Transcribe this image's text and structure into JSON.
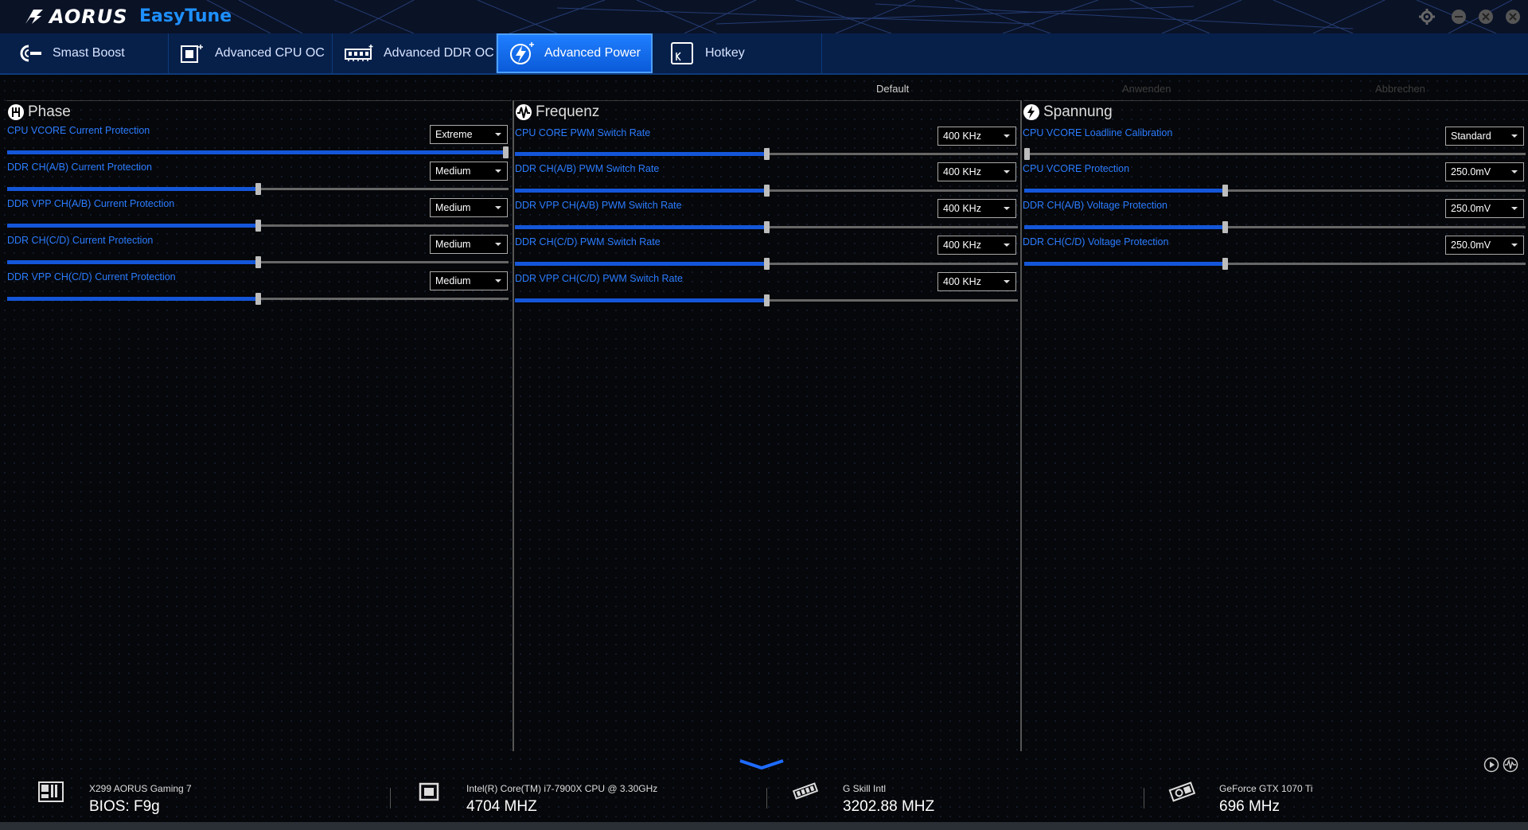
{
  "app": {
    "brand": "AORUS",
    "name": "EasyTune"
  },
  "tabs": [
    {
      "label": "Smast Boost",
      "icon": "smart-boost-icon",
      "active": false
    },
    {
      "label": "Advanced CPU OC",
      "icon": "cpu-chip-icon",
      "active": false
    },
    {
      "label": "Advanced DDR OC",
      "icon": "memory-module-icon",
      "active": false
    },
    {
      "label": "Advanced Power",
      "icon": "lightning-icon",
      "active": true
    },
    {
      "label": "Hotkey",
      "icon": "keyboard-key-icon",
      "active": false
    }
  ],
  "actions": {
    "default": "Default",
    "apply": "Anwenden",
    "cancel": "Abbrechen"
  },
  "colors": {
    "accent": "#1e90ff",
    "label": "#2b7cff",
    "slider_fill": "#1456d9",
    "active_tab": "#1f7fff"
  },
  "panels": [
    {
      "title": "Phase",
      "icon": "phase-icon",
      "rows": [
        {
          "label": "CPU VCORE Current Protection",
          "value": "Extreme",
          "level": 1.0
        },
        {
          "label": "DDR CH(A/B) Current Protection",
          "value": "Medium",
          "level": 0.5
        },
        {
          "label": "DDR VPP CH(A/B) Current Protection",
          "value": "Medium",
          "level": 0.5
        },
        {
          "label": "DDR CH(C/D) Current Protection",
          "value": "Medium",
          "level": 0.5
        },
        {
          "label": "DDR VPP CH(C/D) Current Protection",
          "value": "Medium",
          "level": 0.5
        }
      ]
    },
    {
      "title": "Frequenz",
      "icon": "frequency-icon",
      "rows": [
        {
          "label": "CPU CORE PWM Switch Rate",
          "value": "400 KHz",
          "level": 0.5
        },
        {
          "label": "DDR CH(A/B) PWM Switch Rate",
          "value": "400 KHz",
          "level": 0.5
        },
        {
          "label": "DDR VPP CH(A/B) PWM Switch Rate",
          "value": "400 KHz",
          "level": 0.5
        },
        {
          "label": "DDR CH(C/D) PWM Switch Rate",
          "value": "400 KHz",
          "level": 0.5
        },
        {
          "label": "DDR VPP CH(C/D) PWM Switch Rate",
          "value": "400 KHz",
          "level": 0.5
        }
      ]
    },
    {
      "title": "Spannung",
      "icon": "voltage-icon",
      "rows": [
        {
          "label": "CPU VCORE Loadline Calibration",
          "value": "Standard",
          "level": 0.0
        },
        {
          "label": "CPU VCORE Protection",
          "value": "250.0mV",
          "level": 0.4
        },
        {
          "label": "DDR CH(A/B) Voltage Protection",
          "value": "250.0mV",
          "level": 0.4
        },
        {
          "label": "DDR CH(C/D) Voltage Protection",
          "value": "250.0mV",
          "level": 0.4
        }
      ]
    }
  ],
  "footer": [
    {
      "title": "X299 AORUS Gaming 7",
      "value": "BIOS: F9g",
      "icon": "motherboard-icon"
    },
    {
      "title": "Intel(R) Core(TM) i7-7900X CPU @ 3.30GHz",
      "value": "4704 MHZ",
      "icon": "cpu-icon"
    },
    {
      "title": "G Skill Intl",
      "value": "3202.88 MHZ",
      "icon": "memory-icon"
    },
    {
      "title": "GeForce GTX 1070 Ti",
      "value": "696 MHz",
      "icon": "gpu-icon"
    }
  ]
}
